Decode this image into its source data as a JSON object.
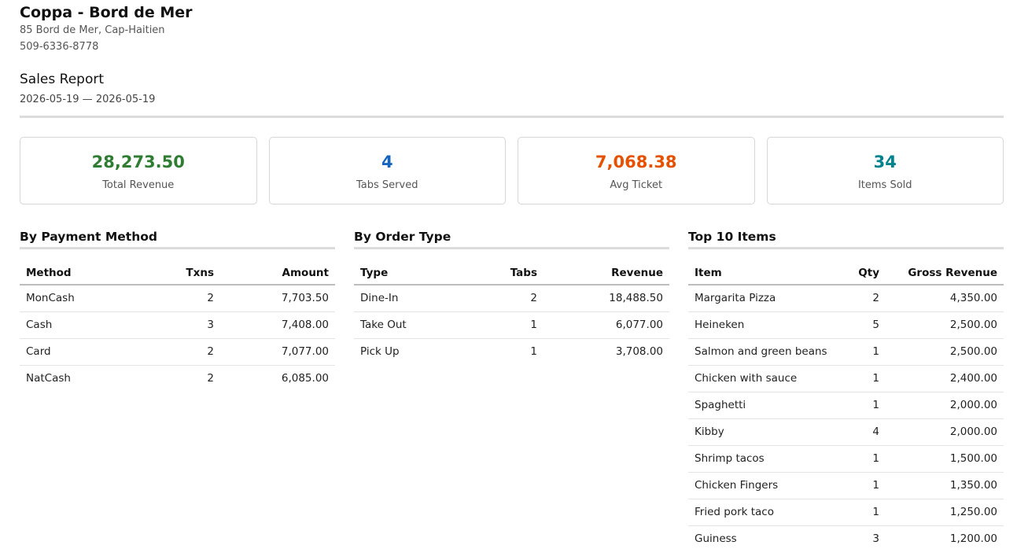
{
  "business": {
    "name": "Coppa - Bord de Mer",
    "address": "85 Bord de Mer, Cap-Haitien",
    "phone": "509-6336-8778"
  },
  "report": {
    "title": "Sales Report",
    "range": "2026-05-19 — 2026-05-19"
  },
  "summary": [
    {
      "value": "28,273.50",
      "label": "Total Revenue",
      "color": "#2e7d32"
    },
    {
      "value": "4",
      "label": "Tabs Served",
      "color": "#1565c0"
    },
    {
      "value": "7,068.38",
      "label": "Avg Ticket",
      "color": "#e65100"
    },
    {
      "value": "34",
      "label": "Items Sold",
      "color": "#00838f"
    }
  ],
  "payment": {
    "title": "By Payment Method",
    "headers": [
      "Method",
      "Txns",
      "Amount"
    ],
    "rows": [
      [
        "MonCash",
        "2",
        "7,703.50"
      ],
      [
        "Cash",
        "3",
        "7,408.00"
      ],
      [
        "Card",
        "2",
        "7,077.00"
      ],
      [
        "NatCash",
        "2",
        "6,085.00"
      ]
    ]
  },
  "order_type": {
    "title": "By Order Type",
    "headers": [
      "Type",
      "Tabs",
      "Revenue"
    ],
    "rows": [
      [
        "Dine-In",
        "2",
        "18,488.50"
      ],
      [
        "Take Out",
        "1",
        "6,077.00"
      ],
      [
        "Pick Up",
        "1",
        "3,708.00"
      ]
    ]
  },
  "top_items": {
    "title": "Top 10 Items",
    "headers": [
      "Item",
      "Qty",
      "Gross Revenue"
    ],
    "rows": [
      [
        "Margarita Pizza",
        "2",
        "4,350.00"
      ],
      [
        "Heineken",
        "5",
        "2,500.00"
      ],
      [
        "Salmon and green beans",
        "1",
        "2,500.00"
      ],
      [
        "Chicken with sauce",
        "1",
        "2,400.00"
      ],
      [
        "Spaghetti",
        "1",
        "2,000.00"
      ],
      [
        "Kibby",
        "4",
        "2,000.00"
      ],
      [
        "Shrimp tacos",
        "1",
        "1,500.00"
      ],
      [
        "Chicken Fingers",
        "1",
        "1,350.00"
      ],
      [
        "Fried pork taco",
        "1",
        "1,250.00"
      ],
      [
        "Guiness",
        "3",
        "1,200.00"
      ]
    ]
  }
}
